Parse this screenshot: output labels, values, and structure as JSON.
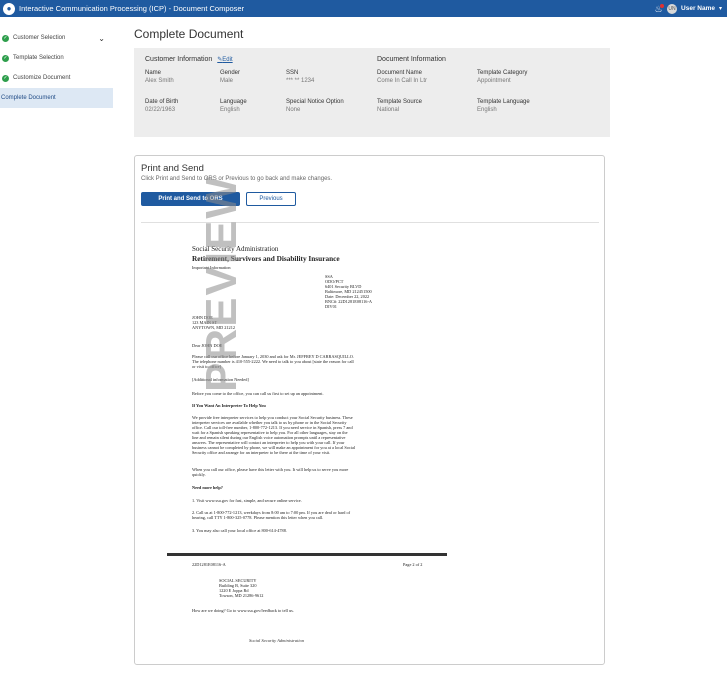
{
  "header": {
    "title": "Interactive Communication Processing (ICP) - Document Composer",
    "user_name": "User Name",
    "avatar_initials": "UN"
  },
  "sidebar": {
    "items": [
      {
        "label": "Customer Selection",
        "done": true
      },
      {
        "label": "Template Selection",
        "done": true
      },
      {
        "label": "Customize Document",
        "done": true
      },
      {
        "label": "Complete Document",
        "done": false
      }
    ]
  },
  "page_title": "Complete Document",
  "customer_info": {
    "title": "Customer Information",
    "edit_label": "Edit",
    "name_label": "Name",
    "name": "Alex Smith",
    "gender_label": "Gender",
    "gender": "Male",
    "ssn_label": "SSN",
    "ssn": "*** ** 1234",
    "dob_label": "Date of Birth",
    "dob": "02/22/1963",
    "language_label": "Language",
    "language": "English",
    "special_notice_label": "Special Notice Option",
    "special_notice": "None"
  },
  "document_info": {
    "title": "Document Information",
    "doc_name_label": "Document Name",
    "doc_name": "Come In Call In Ltr",
    "template_category_label": "Template Category",
    "template_category": "Appointment",
    "template_source_label": "Template Source",
    "template_source": "National",
    "template_language_label": "Template Language",
    "template_language": "English"
  },
  "print_send": {
    "title": "Print and Send",
    "subtitle": "Click Print and Send to ORS or Previous to go back and make changes.",
    "print_button": "Print and Send to ORS",
    "previous_button": "Previous"
  },
  "preview": {
    "watermark": "PREVIEW",
    "agency": "Social Security Administration",
    "program": "Retirement, Survivors and Disability Insurance",
    "important": "Important Information",
    "addr1": "SSA",
    "addr2": "ODO/PCT",
    "addr3": "6401 Security BLVD",
    "addr4": "Baltimore, MD 212451500",
    "addr5": "Date: December 22, 2022",
    "addr6": "BNC#: 22D1281E08116-A",
    "addr7": "DIV01",
    "recipient1": "JOHN DOE",
    "recipient2": "123 MAIN ST",
    "recipient3": "ANYTOWN, MD 21212",
    "salutation": "Dear JOHN DOE",
    "p1a": "Please call our office before January 1, 2030 and ask for Mr. JEFFREY D CARRASQUILLO.",
    "p1b": "The telephone number is 410-555-2222. We need to talk to you about [state the reason for call",
    "p1c": "or visit to office]",
    "p2": "[Additional information Needed]",
    "p3": "Before you come to the office, you can call us first to set up an appointment.",
    "h_interp": "If You Want An Interpreter To Help You",
    "p4a": "We provide free interpreter services to help you conduct your Social Security business. These",
    "p4b": "interpreter services are available whether you talk to us by phone or in the Social Security",
    "p4c": "office. Call our toll-free number, 1-800-772-1213. If you need service in Spanish, press 7 and",
    "p4d": "wait for a Spanish speaking representative to help you. For all other languages, stay on the",
    "p4e": "line and remain silent during our English voice automation prompts until a representative",
    "p4f": "answers. The representative will contact an interpreter to help you with your call. If your",
    "p4g": "business cannot be completed by phone, we will make an appointment for you at a local Social",
    "p4h": "Security office and arrange for an interpreter to be there at the time of your visit.",
    "p5a": "When you call our office, please have this letter with you. It will help us to serve you more",
    "p5b": "quickly.",
    "h_help": "Need more help?",
    "li1": "1. Visit www.ssa.gov for fast, simple, and secure online service.",
    "li2a": "2. Call us at 1-800-772-1213, weekdays from 8:00 am to 7:00 pm. If you are deaf or hard of",
    "li2b": "hearing, call TTY 1-800-325-0778. Please mention this letter when you call.",
    "li3": "3. You may also call your local office at 800-614-4788.",
    "footer_code": "22D1281E08116-A",
    "footer_page": "Page 2 of 2",
    "ret1": "SOCIAL SECURITY",
    "ret2": "Building B, Suite 320",
    "ret3": "1220 E Joppa Rd",
    "ret4": "Towson, MD 21286-9612",
    "feedback": "How are we doing? Go to www.ssa.gov/feedback to tell us.",
    "signature": "Social Security Administration"
  },
  "colors": {
    "header_bg": "#1f5aa0",
    "primary": "#1f5aa0",
    "success": "#2e9e4c",
    "panel_bg": "#ededed"
  },
  "icons": [
    "app-logo-icon",
    "bell-icon",
    "check-circle-icon",
    "chevron-down-icon",
    "edit-pencil-icon",
    "caret-down-icon"
  ]
}
